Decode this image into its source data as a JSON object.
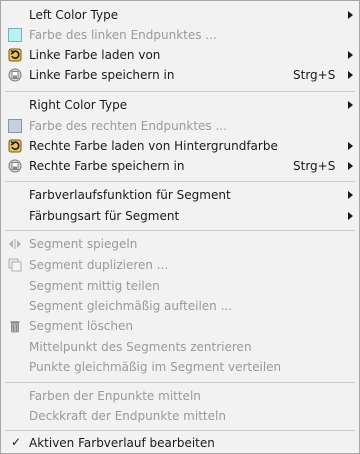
{
  "menu": {
    "left_color_type": "Left Color Type",
    "left_endpoint_color": "Farbe des linken Endpunktes ...",
    "load_left_color": "Linke Farbe laden von",
    "save_left_color": "Linke Farbe speichern in",
    "save_left_shortcut": "Strg+S",
    "right_color_type": "Right Color Type",
    "right_endpoint_color": "Farbe des rechten Endpunktes ...",
    "load_right_color": "Rechte Farbe laden von Hintergrundfarbe",
    "save_right_color": "Rechte Farbe speichern in",
    "save_right_shortcut": "Strg+S",
    "blending_function": "Farbverlaufsfunktion für Segment",
    "coloring_type": "Färbungsart für Segment",
    "flip_segment": "Segment spiegeln",
    "replicate_segment": "Segment duplizieren ...",
    "split_midpoint": "Segment mittig teilen",
    "split_uniformly": "Segment gleichmäßig aufteilen ...",
    "delete_segment": "Segment löschen",
    "recenter_midpoint": "Mittelpunkt des Segments zentrieren",
    "redistribute_handles": "Punkte gleichmäßig im Segment verteilen",
    "blend_endpoint_colors": "Farben der Enpunkte mitteln",
    "blend_endpoint_opacity": "Deckkraft der Endpunkte mitteln",
    "edit_active_gradient": "Aktiven Farbverlauf bearbeiten",
    "check_mark": "✓"
  },
  "colors": {
    "left_swatch": "#b8f2f2",
    "right_swatch": "#c8d0dc"
  }
}
